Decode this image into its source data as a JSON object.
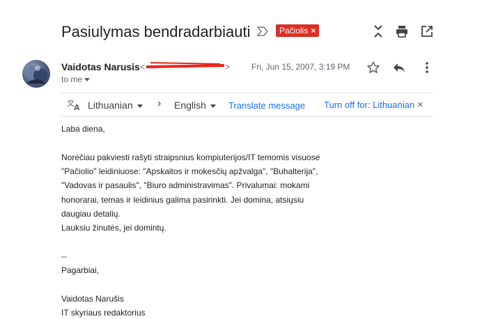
{
  "email": {
    "subject": "Pasiulymas bendradarbiauti",
    "label": "Pačiolis",
    "label_close": "×",
    "sender_name": "Vaidotas Narusis",
    "sender_email_open": "<",
    "sender_email_close": ">",
    "date": "Fri, Jun 15, 2007, 3:19 PM",
    "to": "to me"
  },
  "translate": {
    "source_lang": "Lithuanian",
    "arrow": "›",
    "target_lang": "English",
    "translate_link": "Translate message",
    "turn_off": "Turn off for: Lithuanian",
    "close": "×"
  },
  "body": {
    "lines": [
      "Laba diena,",
      "",
      "Norėčiau pakviesti rašyti straipsnius kompiuterijos/IT temomis visuose",
      "\"Pačiolio\" leidiniuose: \"Apskaitos ir mokesčių apžvalga\", \"Buhalterija\",",
      "\"Vadovas ir pasaulis\", \"Biuro administravimas\". Privalumai: mokami",
      "honorarai, temas ir leidinius galima pasirinkti. Jei domina, atsiųsiu",
      "daugiau detalių.",
      "Lauksiu žinutės, jei domintų.",
      "",
      "--",
      "Pagarbiai,",
      "",
      "Vaidotas Narušis",
      "IT skyriaus redaktorius"
    ]
  },
  "icons": {
    "importance": "importance-marker-icon",
    "expand": "expand-collapse-icon",
    "print": "print-icon",
    "popout": "open-new-window-icon",
    "star": "star-icon",
    "reply": "reply-icon",
    "more": "more-vert-icon",
    "translate": "translate-icon"
  },
  "colors": {
    "label_bg": "#d93025",
    "link": "#1a73e8",
    "redaction": "#e8261c"
  }
}
